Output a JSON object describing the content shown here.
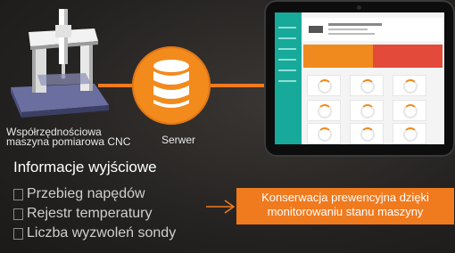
{
  "diagram": {
    "machine_label_line1": "Współrzędnościowa",
    "machine_label_line2": "maszyna pomiarowa CNC",
    "server_label": "Serwer",
    "output_title": "Informacje wyjściowe",
    "outputs": [
      "Przebieg napędów",
      "Rejestr temperatury",
      "Liczba wyzwoleń sondy"
    ],
    "result_line1": "Konserwacja prewencyjna dzięki",
    "result_line2": "monitorowaniu stanu maszyny"
  },
  "colors": {
    "accent": "#f07a1e",
    "server_circle": "#f28a1c",
    "background": "#232120",
    "screen_sidebar": "#17a99a"
  },
  "icons": {
    "server": "database-icon",
    "arrow": "arrow-right-icon"
  }
}
